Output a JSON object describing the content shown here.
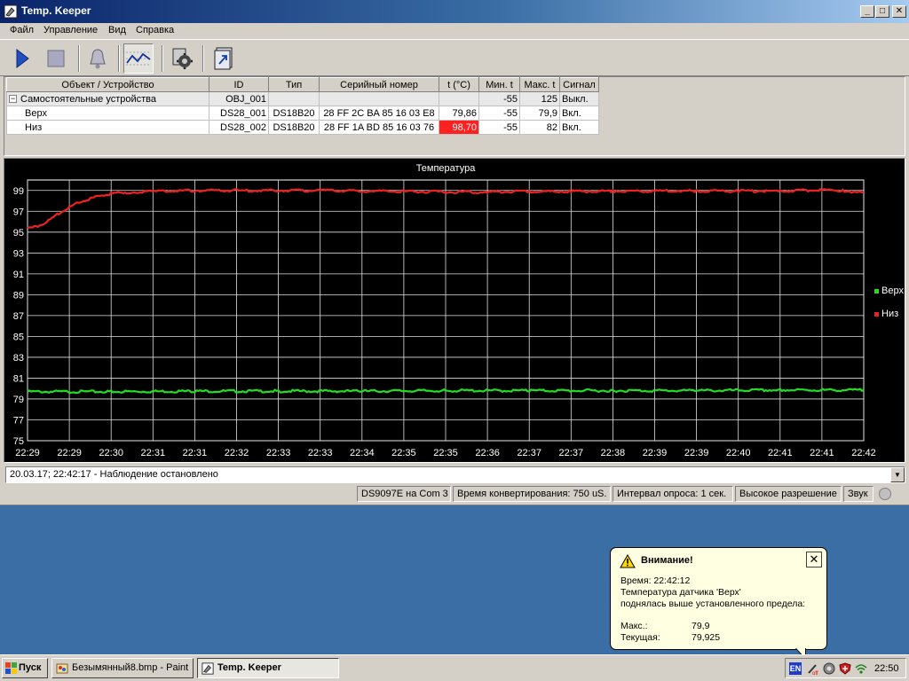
{
  "window": {
    "title": "Temp. Keeper",
    "min_glyph": "_",
    "max_glyph": "□",
    "close_glyph": "✕"
  },
  "menu": [
    "Файл",
    "Управление",
    "Вид",
    "Справка"
  ],
  "toolbar": {
    "buttons": [
      {
        "name": "play-button",
        "icon": "play-icon"
      },
      {
        "name": "stop-button",
        "icon": "stop-icon"
      },
      {
        "name": "alarm-button",
        "icon": "bell-icon"
      },
      {
        "name": "chart-button",
        "icon": "chart-icon"
      },
      {
        "name": "settings-button",
        "icon": "gear-icon"
      },
      {
        "name": "export-button",
        "icon": "export-icon"
      }
    ]
  },
  "table": {
    "headers": [
      "Объект / Устройство",
      "ID",
      "Тип",
      "Серийный номер",
      "t (°C)",
      "Мин. t",
      "Макс. t",
      "Сигнал"
    ],
    "group": {
      "toggle": "−",
      "name": "Самостоятельные устройства",
      "id": "OBJ_001",
      "min": "-55",
      "max": "125",
      "signal": "Выкл."
    },
    "rows": [
      {
        "name": "Верх",
        "id": "DS28_001",
        "type": "DS18B20",
        "serial": "28 FF 2C BA 85 16 03 E8",
        "t": "79,86",
        "min": "-55",
        "max": "79,9",
        "signal": "Вкл."
      },
      {
        "name": "Низ",
        "id": "DS28_002",
        "type": "DS18B20",
        "serial": "28 FF 1A BD 85 16 03 76",
        "t": "98,70",
        "min": "-55",
        "max": "82",
        "signal": "Вкл."
      }
    ]
  },
  "chart_data": {
    "type": "line",
    "title": "Температура",
    "xlabel": "",
    "ylabel": "",
    "ylim": [
      75,
      100
    ],
    "yticks": [
      99,
      97,
      95,
      93,
      91,
      89,
      87,
      85,
      83,
      81,
      79,
      77,
      75
    ],
    "xtick_labels": [
      "22:29",
      "22:29",
      "22:30",
      "22:31",
      "22:31",
      "22:32",
      "22:33",
      "22:33",
      "22:34",
      "22:35",
      "22:35",
      "22:36",
      "22:37",
      "22:37",
      "22:38",
      "22:39",
      "22:39",
      "22:40",
      "22:41",
      "22:41",
      "22:42"
    ],
    "grid": true,
    "legend_position": "right",
    "series": [
      {
        "name": "Верх",
        "color": "#22dd22",
        "x": [
          0,
          2,
          4,
          6,
          8,
          10,
          12,
          14,
          16,
          18,
          20
        ],
        "values": [
          79.7,
          79.7,
          79.75,
          79.75,
          79.75,
          79.8,
          79.8,
          79.8,
          79.8,
          79.85,
          79.85
        ]
      },
      {
        "name": "Низ",
        "color": "#ee2222",
        "x": [
          0,
          0.25,
          0.5,
          0.75,
          1,
          1.25,
          1.5,
          1.75,
          2,
          2.5,
          3,
          4,
          5,
          6,
          7,
          8,
          9,
          10,
          11,
          12,
          13,
          14,
          15,
          16,
          17,
          18,
          19,
          19.5,
          20
        ],
        "values": [
          95.3,
          95.6,
          96.1,
          96.8,
          97.4,
          97.9,
          98.2,
          98.5,
          98.7,
          98.85,
          98.9,
          99.0,
          99.0,
          99.0,
          99.0,
          98.95,
          98.9,
          98.85,
          98.85,
          98.9,
          98.9,
          98.95,
          98.95,
          98.95,
          98.95,
          98.95,
          99.05,
          98.95,
          98.8
        ]
      }
    ]
  },
  "log": {
    "text": "20.03.17; 22:42:17 - Наблюдение остановлено",
    "drop_glyph": "▼"
  },
  "status": {
    "port": "DS9097E на Com 3",
    "conv_time": "Время конвертирования: 750 uS.",
    "interval": "Интервал опроса: 1 сек.",
    "resolution": "Высокое разрешение",
    "sound": "Звук"
  },
  "balloon": {
    "title": "Внимание!",
    "close_glyph": "✕",
    "time_line": "Время: 22:42:12",
    "message_line1": "Температура датчика 'Верх'",
    "message_line2": "поднялась выше установленного предела:",
    "max_label": "Макс.:",
    "max_value": "79,9",
    "current_label": "Текущая:",
    "current_value": "79,925"
  },
  "taskbar": {
    "start": "Пуск",
    "tasks": [
      "Безымянный8.bmp - Paint",
      "Temp. Keeper"
    ],
    "lang": "EN",
    "clock": "22:50"
  }
}
